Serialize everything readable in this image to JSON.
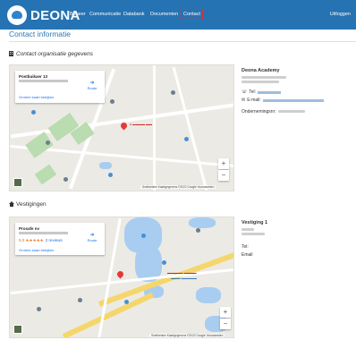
{
  "nav": {
    "brand": "DEONA",
    "items": [
      {
        "label": "Beheer"
      },
      {
        "label": "Communicatie"
      },
      {
        "label": "Databank"
      },
      {
        "label": "Documenten"
      },
      {
        "label": "Contact"
      }
    ],
    "logout": "Uitloggen"
  },
  "page": {
    "title": "Contact informatie"
  },
  "section1": {
    "heading": "Contact organisatie gegevens",
    "map": {
      "card_title": "Postbuikaer 13",
      "card_link": "Grotere kaart bekijken",
      "directions": "Route",
      "attribution": [
        "Sneltoetsen",
        "Kaartgegevens ©2022 Google",
        "Voorwaarden"
      ]
    },
    "info": {
      "title": "Deona Academy",
      "phone_label": "Tel:",
      "email_label": "E-mail:",
      "company_label": "Ondernemingsnr:"
    }
  },
  "section2": {
    "heading": "Vestigingen",
    "map": {
      "card_title": "Prosafe nv",
      "rating": "5,0 ★★★★★",
      "reviews": "2 reviews",
      "card_link": "Grotere kaart bekijken",
      "directions": "Route",
      "attribution": [
        "Sneltoetsen",
        "Kaartgegevens ©2022 Google",
        "Voorwaarden"
      ]
    },
    "info": {
      "title": "Vestiging 1",
      "phone_label": "Tel:",
      "extra": "Email"
    }
  },
  "colors": {
    "nav_bg": "#2573b3",
    "title": "#2d76b6",
    "pin": "#e53935"
  }
}
